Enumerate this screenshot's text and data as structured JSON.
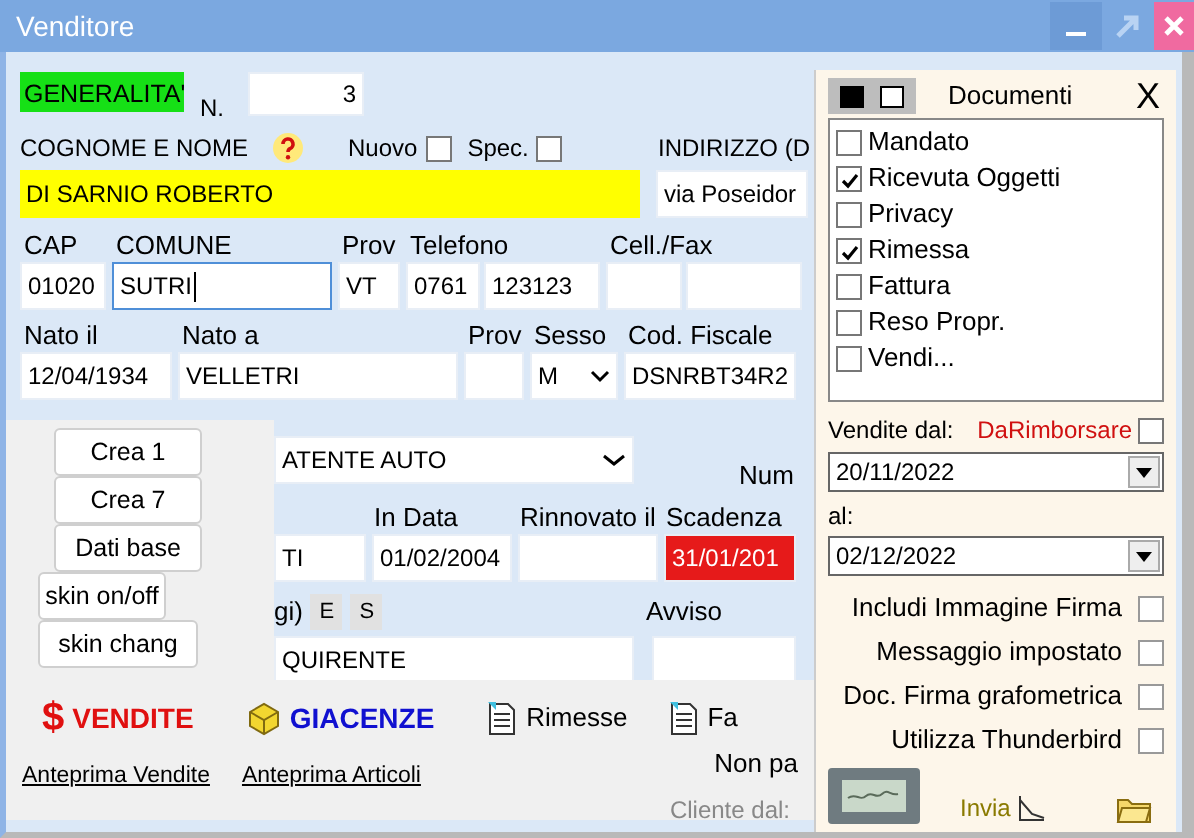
{
  "window": {
    "title": "Venditore"
  },
  "header": {
    "section": "GENERALITA'",
    "number_label": "N.",
    "number": "3"
  },
  "name_row": {
    "label": "COGNOME E NOME",
    "flags": [
      {
        "label": "Nuovo",
        "checked": false
      },
      {
        "label": "Spec.",
        "checked": false
      }
    ],
    "address_label": "INDIRIZZO (D"
  },
  "name": "DI SARNIO ROBERTO",
  "address": "via Poseidor",
  "row_a": [
    {
      "label": "CAP",
      "fields": [
        {
          "value": "01020",
          "focused": false
        }
      ]
    },
    {
      "label": "COMUNE",
      "fields": [
        {
          "value": "SUTRI",
          "focused": true
        }
      ]
    },
    {
      "label": "Prov",
      "fields": [
        {
          "value": "VT",
          "focused": false
        }
      ]
    },
    {
      "label": "Telefono",
      "fields": [
        {
          "value": "0761",
          "focused": false
        },
        {
          "value": "123123",
          "focused": false
        }
      ]
    },
    {
      "label": "Cell./Fax",
      "fields": [
        {
          "focused": false
        },
        {
          "focused": false
        }
      ]
    }
  ],
  "row_b": [
    {
      "label": "Nato il",
      "fields": [
        {
          "value": "12/04/1934",
          "kind": "text"
        }
      ]
    },
    {
      "label": "Nato a",
      "fields": [
        {
          "value": "VELLETRI",
          "kind": "text"
        }
      ]
    },
    {
      "label": "Prov",
      "fields": [
        {
          "kind": "text"
        }
      ]
    },
    {
      "label": "Sesso",
      "fields": [
        {
          "value": "M",
          "kind": "select"
        }
      ]
    },
    {
      "label": "Cod. Fiscale",
      "fields": [
        {
          "value": "DSNRBT34R2",
          "kind": "text"
        }
      ]
    }
  ],
  "tool_buttons": [
    "Crea 1",
    "Crea 7",
    "Dati base",
    "skin on/off",
    "skin chang"
  ],
  "document": {
    "type": "ATENTE AUTO",
    "number_label": "Num",
    "dates": [
      {
        "value": "TI",
        "expired": false
      },
      {
        "label": "In Data",
        "value": "01/02/2004",
        "expired": false
      },
      {
        "label": "Rinnovato il",
        "expired": false
      },
      {
        "label": "Scadenza",
        "value": "31/01/201",
        "expired": true
      }
    ],
    "note_label": "gi)",
    "note_buttons": [
      "E",
      "S"
    ],
    "warning_label": "Avviso",
    "note": "QUIRENTE"
  },
  "actions": [
    {
      "symbol": "$",
      "label": "VENDITE",
      "kind": "sales"
    },
    {
      "label": "GIACENZE",
      "kind": "stock"
    },
    {
      "label": "Rimesse",
      "kind": "doc"
    },
    {
      "label": "Fa",
      "kind": "doc"
    }
  ],
  "links": [
    "Anteprima Vendite",
    "Anteprima Articoli"
  ],
  "unpaid_label": "Non pa",
  "client_since_label": "Cliente dal:",
  "documents_panel": {
    "title": "Documenti",
    "close": "X",
    "items": [
      {
        "label": "Mandato",
        "checked": false
      },
      {
        "label": "Ricevuta Oggetti",
        "checked": true
      },
      {
        "label": "Privacy",
        "checked": false
      },
      {
        "label": "Rimessa",
        "checked": true
      },
      {
        "label": "Fattura",
        "checked": false
      },
      {
        "label": "Reso Propr.",
        "checked": false
      },
      {
        "label": "Vendi...",
        "checked": false
      }
    ],
    "from_label": "Vendite dal:",
    "refund": {
      "label": "DaRimborsare",
      "checked": false
    },
    "from_date": "20/11/2022",
    "to_label": "al:",
    "to_date": "02/12/2022",
    "options": [
      {
        "label": "Includi Immagine Firma",
        "checked": false
      },
      {
        "label": "Messaggio impostato",
        "checked": false
      },
      {
        "label": "Doc.  Firma grafometrica",
        "checked": false
      },
      {
        "label": "Utilizza Thunderbird",
        "checked": false
      }
    ],
    "send_label": "Invia"
  }
}
